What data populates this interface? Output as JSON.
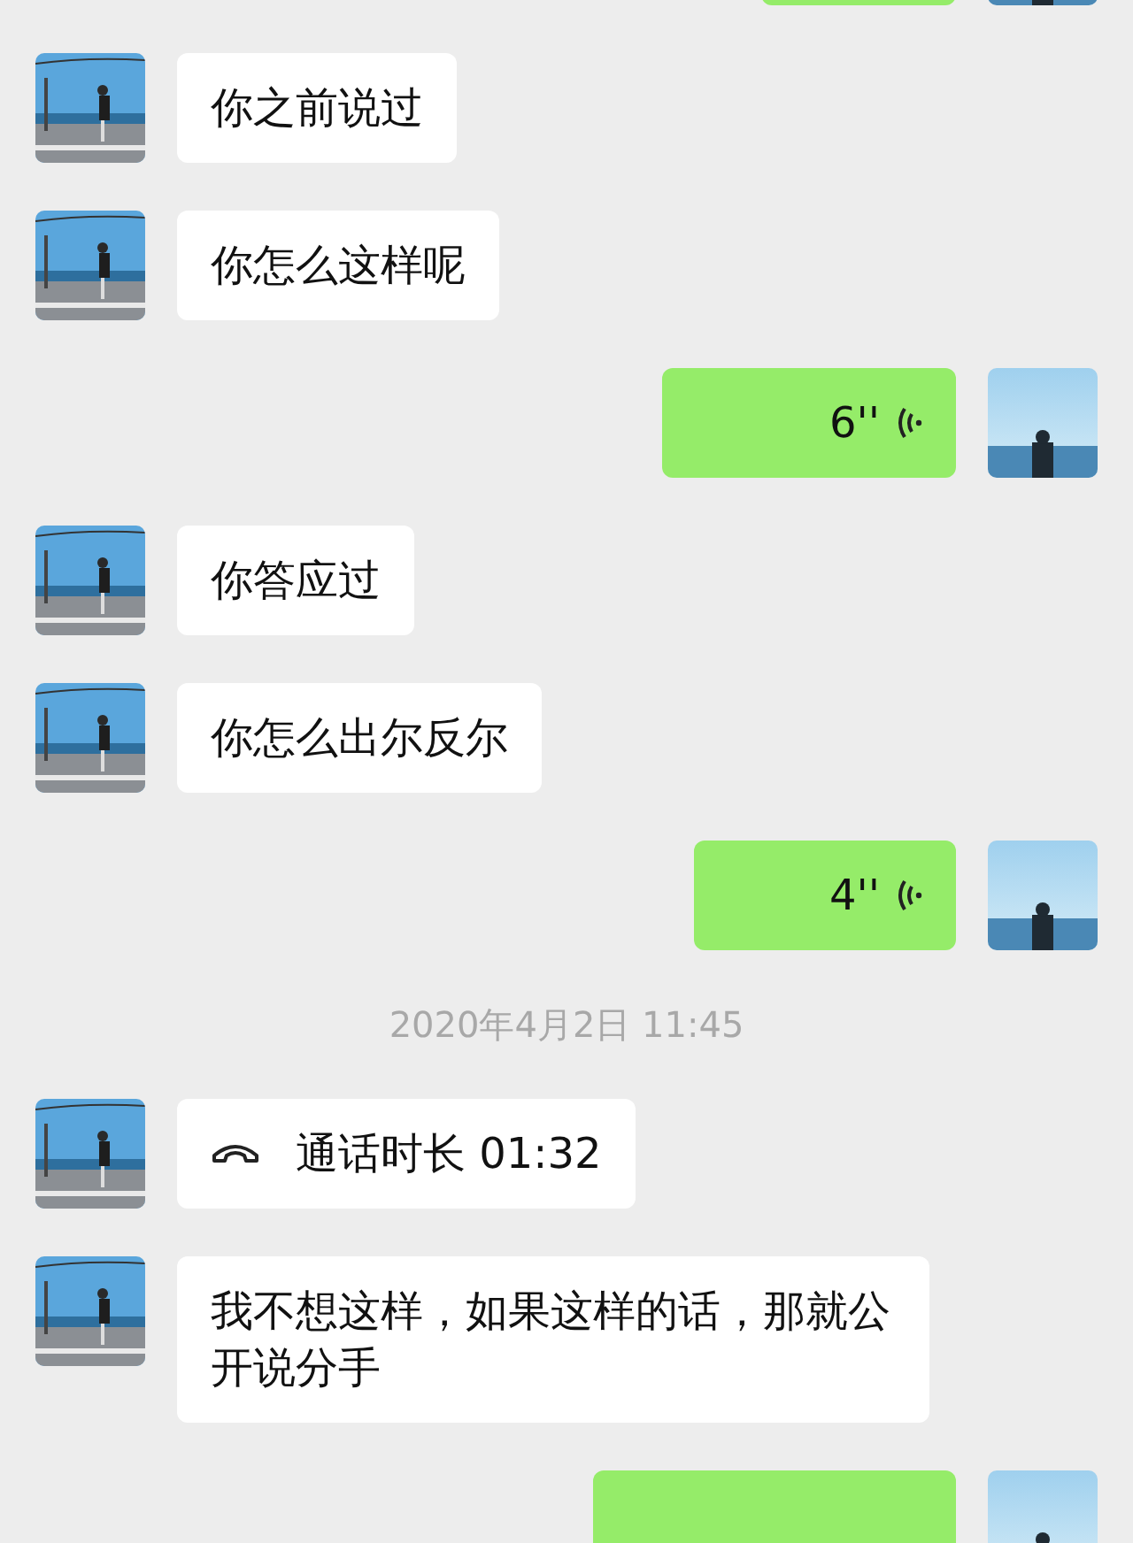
{
  "messages": [
    {
      "outgoing": true,
      "kind": "clipped"
    },
    {
      "outgoing": false,
      "kind": "text",
      "text": "你之前说过"
    },
    {
      "outgoing": false,
      "kind": "text",
      "text": "你怎么这样呢"
    },
    {
      "outgoing": true,
      "kind": "voice",
      "duration": "6''"
    },
    {
      "outgoing": false,
      "kind": "text",
      "text": "你答应过"
    },
    {
      "outgoing": false,
      "kind": "text",
      "text": "你怎么出尔反尔"
    },
    {
      "outgoing": true,
      "kind": "voice",
      "duration": "4''"
    },
    {
      "kind": "time",
      "text": "2020年4月2日 11:45"
    },
    {
      "outgoing": false,
      "kind": "call",
      "text": "通话时长 01:32"
    },
    {
      "outgoing": false,
      "kind": "text",
      "text": "我不想这样，如果这样的话，那就公开说分手"
    },
    {
      "outgoing": true,
      "kind": "clipped"
    }
  ]
}
